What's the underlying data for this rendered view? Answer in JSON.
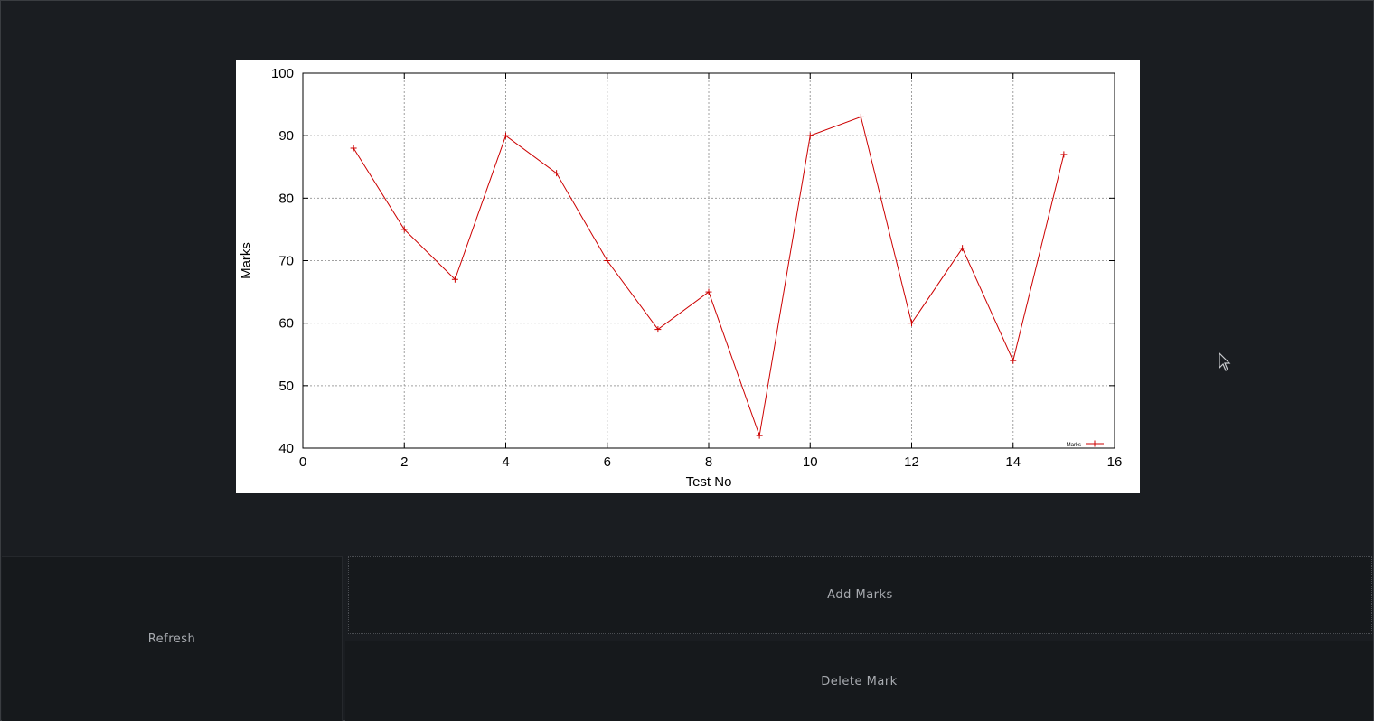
{
  "buttons": {
    "refresh": "Refresh",
    "add_marks": "Add Marks",
    "delete_mark": "Delete Mark"
  },
  "chart_data": {
    "type": "line",
    "title": "",
    "xlabel": "Test No",
    "ylabel": "Marks",
    "xlim": [
      0,
      16
    ],
    "ylim": [
      40,
      100
    ],
    "xticks": [
      0,
      2,
      4,
      6,
      8,
      10,
      12,
      14,
      16
    ],
    "yticks": [
      40,
      50,
      60,
      70,
      80,
      90,
      100
    ],
    "grid": true,
    "legend": "bottom-right",
    "series": [
      {
        "name": "Marks",
        "color": "#cc0000",
        "marker": "plus",
        "x": [
          1,
          2,
          3,
          4,
          5,
          6,
          7,
          8,
          9,
          10,
          11,
          12,
          13,
          14,
          15
        ],
        "y": [
          88,
          75,
          67,
          90,
          84,
          70,
          59,
          65,
          42,
          90,
          93,
          60,
          72,
          54,
          87
        ]
      }
    ]
  },
  "colors": {
    "background": "#1a1d21",
    "button_bg": "#16191c",
    "button_text": "#a8abb0",
    "series": "#cc0000"
  }
}
